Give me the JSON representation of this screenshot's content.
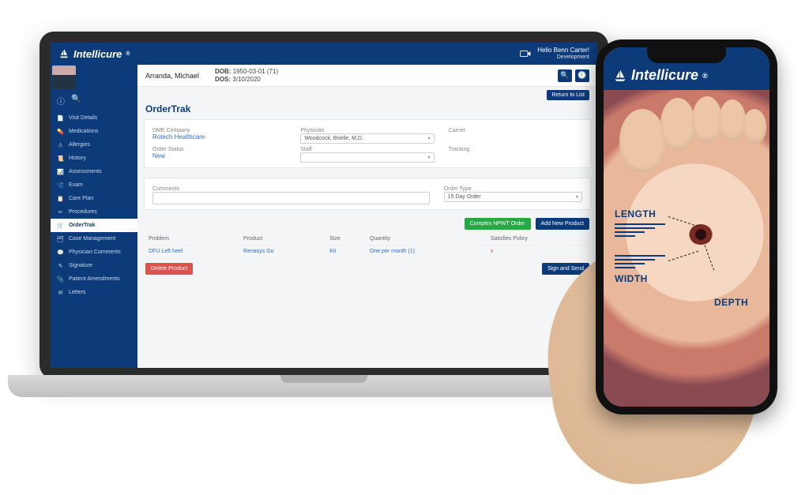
{
  "brand": "Intellicure",
  "header": {
    "hello_line": "Hello Benn Carter!",
    "org_line": "Development"
  },
  "patient": {
    "name": "Arranda, Michael",
    "dob_label": "DOB:",
    "dob_value": "1950-03-01 (71)",
    "dos_label": "DOS:",
    "dos_value": "3/10/2020"
  },
  "buttons": {
    "return_to_list": "Return to List",
    "complex_npwt": "Complex NPWT Order",
    "add_new_product": "Add New Product",
    "delete_product": "Delete Product",
    "sign_send": "Sign and Send"
  },
  "page_title": "OrderTrak",
  "form": {
    "dme_company": {
      "label": "DME Company",
      "value": "Rotech Healthcare"
    },
    "physician": {
      "label": "Physician",
      "value": "Woodcock, Brielle, M.D."
    },
    "carrier": {
      "label": "Carrier",
      "value": ""
    },
    "order_status": {
      "label": "Order Status",
      "value": "New"
    },
    "staff": {
      "label": "Staff",
      "value": ""
    },
    "tracking": {
      "label": "Tracking",
      "value": ""
    },
    "comments": {
      "label": "Comments",
      "value": ""
    },
    "order_type": {
      "label": "Order Type",
      "value": "15 Day Order"
    }
  },
  "order_table": {
    "headers": {
      "problem": "Problem",
      "product": "Product",
      "size": "Size",
      "quantity": "Quantity",
      "satisfies": "Satisfies Policy"
    },
    "row": {
      "problem": "DFU Left heel",
      "product": "Renasys Go",
      "size": "Kit",
      "quantity": "One per month (1)",
      "satisfies": "x"
    }
  },
  "sidebar": {
    "items": [
      "Visit Details",
      "Medications",
      "Allergies",
      "History",
      "Assessments",
      "Exam",
      "Care Plan",
      "Procedures",
      "OrderTrak",
      "Case Management",
      "Physician Comments",
      "Signature",
      "Patient Amendments",
      "Letters"
    ],
    "active_index": 8
  },
  "phone": {
    "labels": {
      "length": "LENGTH",
      "width": "WIDTH",
      "depth": "DEPTH"
    }
  }
}
